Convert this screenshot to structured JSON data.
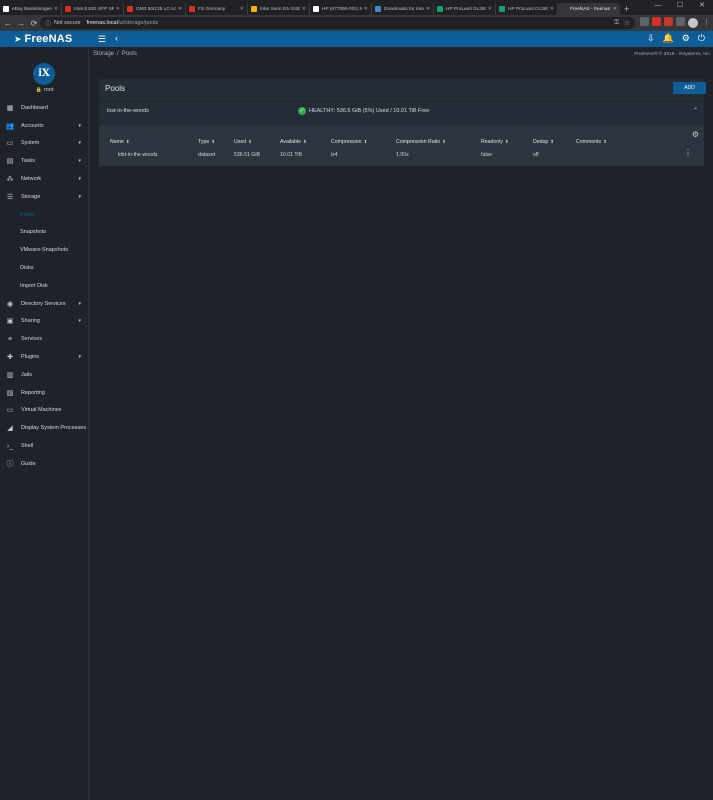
{
  "browser": {
    "tabs": [
      {
        "title": "eBay Bestellungen",
        "color": "#ffffff",
        "active": false
      },
      {
        "title": "Intel E10G SFP SR",
        "color": "#d93025",
        "active": false
      },
      {
        "title": "OM3 50/125 LC-LC",
        "color": "#d93025",
        "active": false
      },
      {
        "title": "FS Germany",
        "color": "#d93025",
        "active": false
      },
      {
        "title": "Intel Xeon E5-2430",
        "color": "#f4b400",
        "active": false
      },
      {
        "title": "HP (677090-001) M",
        "color": "#ffffff",
        "active": false
      },
      {
        "title": "Downloads for Intel",
        "color": "#4a86c5",
        "active": false
      },
      {
        "title": "HP ProLiant DL380",
        "color": "#1a9e6b",
        "active": false
      },
      {
        "title": "HP ProLiant DL380",
        "color": "#1a9e6b",
        "active": false
      },
      {
        "title": "FreeNAS - freenas",
        "color": "#35363a",
        "active": true
      }
    ],
    "new_tab": "+",
    "window_controls": {
      "minimize": "—",
      "maximize": "☐",
      "close": "✕"
    },
    "back": "←",
    "forward": "→",
    "reload": "⟳",
    "security": "Not secure",
    "url_host": "freenas.local",
    "url_path": "/ui/storage/pools"
  },
  "topbar": {
    "brand": "FreeNAS",
    "accent": "#0f5d97"
  },
  "sidebar": {
    "logo_text": "iX",
    "user": "root",
    "items": [
      {
        "label": "Dashboard",
        "icon": "▦",
        "caret": ""
      },
      {
        "label": "Accounts",
        "icon": "👥",
        "caret": "▾"
      },
      {
        "label": "System",
        "icon": "▭",
        "caret": "▾"
      },
      {
        "label": "Tasks",
        "icon": "▤",
        "caret": "▾"
      },
      {
        "label": "Network",
        "icon": "⁂",
        "caret": "▾"
      },
      {
        "label": "Storage",
        "icon": "☰",
        "caret": "▾"
      },
      {
        "label": "Pools",
        "sub": true,
        "active": true
      },
      {
        "label": "Snapshots",
        "sub": true
      },
      {
        "label": "VMware-Snapshots",
        "sub": true
      },
      {
        "label": "Disks",
        "sub": true
      },
      {
        "label": "Import Disk",
        "sub": true
      },
      {
        "label": "Directory Services",
        "icon": "◉",
        "caret": "▾"
      },
      {
        "label": "Sharing",
        "icon": "▣",
        "caret": "▾"
      },
      {
        "label": "Services",
        "icon": "≡",
        "caret": ""
      },
      {
        "label": "Plugins",
        "icon": "✚",
        "caret": "▾"
      },
      {
        "label": "Jails",
        "icon": "▥",
        "caret": ""
      },
      {
        "label": "Reporting",
        "icon": "▨",
        "caret": ""
      },
      {
        "label": "Virtual Machines",
        "icon": "▭",
        "caret": ""
      },
      {
        "label": "Display System Processes",
        "icon": "◢",
        "caret": ""
      },
      {
        "label": "Shell",
        "icon": "›_",
        "caret": ""
      },
      {
        "label": "Guide",
        "icon": "ⓘ",
        "caret": ""
      }
    ]
  },
  "breadcrumb": {
    "parent": "Storage",
    "sep": "/",
    "current": "Pools"
  },
  "copyright": "FreeNAS® © 2019 - iXsystems, Inc.",
  "pools_card": {
    "title": "Pools",
    "add_label": "ADD",
    "pool_name": "lost-in-the-woods",
    "status": "HEALTHY: 536.5 GiB (5%) Used / 10.01 TiB Free"
  },
  "table": {
    "columns": [
      "Name",
      "Type",
      "Used",
      "Available",
      "Compression",
      "Compression Ratio",
      "Readonly",
      "Dedup",
      "Comments"
    ],
    "row": [
      "lost-in-the-woods",
      "dataset",
      "536.51 GiB",
      "10.01 TiB",
      "lz4",
      "1.00x",
      "false",
      "off",
      ""
    ]
  }
}
